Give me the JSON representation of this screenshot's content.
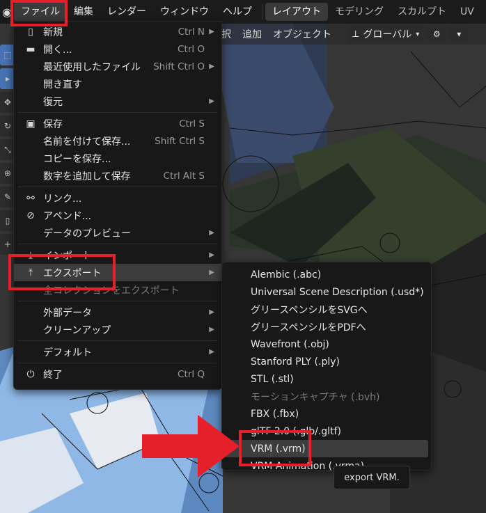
{
  "menubar": {
    "items": [
      "ファイル",
      "編集",
      "レンダー",
      "ウィンドウ",
      "ヘルプ"
    ],
    "workspaces": [
      "レイアウト",
      "モデリング",
      "スカルプト",
      "UV"
    ]
  },
  "viewport_header": {
    "items": [
      "択",
      "追加",
      "オブジェクト"
    ],
    "orientation": "グローバル"
  },
  "file_menu": {
    "groups": [
      [
        {
          "label": "新規",
          "shortcut": "Ctrl N",
          "arrow": true,
          "icon": "file-new-icon"
        },
        {
          "label": "開く...",
          "shortcut": "Ctrl O",
          "arrow": false,
          "icon": "folder-icon"
        },
        {
          "label": "最近使用したファイル",
          "shortcut": "Shift Ctrl O",
          "arrow": true,
          "icon": ""
        },
        {
          "label": "開き直す",
          "shortcut": "",
          "arrow": false,
          "icon": ""
        },
        {
          "label": "復元",
          "shortcut": "",
          "arrow": true,
          "icon": ""
        }
      ],
      [
        {
          "label": "保存",
          "shortcut": "Ctrl S",
          "arrow": false,
          "icon": "save-icon"
        },
        {
          "label": "名前を付けて保存...",
          "shortcut": "Shift Ctrl S",
          "arrow": false,
          "icon": ""
        },
        {
          "label": "コピーを保存...",
          "shortcut": "",
          "arrow": false,
          "icon": ""
        },
        {
          "label": "数字を追加して保存",
          "shortcut": "Ctrl Alt S",
          "arrow": false,
          "icon": ""
        }
      ],
      [
        {
          "label": "リンク...",
          "shortcut": "",
          "arrow": false,
          "icon": "link-icon"
        },
        {
          "label": "アペンド...",
          "shortcut": "",
          "arrow": false,
          "icon": "append-icon"
        },
        {
          "label": "データのプレビュー",
          "shortcut": "",
          "arrow": true,
          "icon": ""
        }
      ],
      [
        {
          "label": "インポート",
          "shortcut": "",
          "arrow": true,
          "icon": "import-icon"
        },
        {
          "label": "エクスポート",
          "shortcut": "",
          "arrow": true,
          "icon": "export-icon",
          "highlighted": true
        },
        {
          "label": "全コレクションをエクスポート",
          "shortcut": "",
          "arrow": false,
          "icon": "",
          "disabled": true
        }
      ],
      [
        {
          "label": "外部データ",
          "shortcut": "",
          "arrow": true,
          "icon": ""
        },
        {
          "label": "クリーンアップ",
          "shortcut": "",
          "arrow": true,
          "icon": ""
        }
      ],
      [
        {
          "label": "デフォルト",
          "shortcut": "",
          "arrow": true,
          "icon": ""
        }
      ],
      [
        {
          "label": "終了",
          "shortcut": "Ctrl Q",
          "arrow": false,
          "icon": "power-icon"
        }
      ]
    ]
  },
  "export_menu": {
    "items": [
      {
        "label": "Alembic (.abc)"
      },
      {
        "label": "Universal Scene Description (.usd*)"
      },
      {
        "label": "グリースペンシルをSVGへ"
      },
      {
        "label": "グリースペンシルをPDFへ"
      },
      {
        "label": "Wavefront (.obj)"
      },
      {
        "label": "Stanford PLY (.ply)"
      },
      {
        "label": "STL (.stl)"
      },
      {
        "label": "モーションキャプチャ (.bvh)",
        "disabled": true
      },
      {
        "label": "FBX (.fbx)"
      },
      {
        "label": "glTF 2.0 (.glb/.gltf)"
      },
      {
        "label": "VRM (.vrm)",
        "highlighted": true
      },
      {
        "label": "VRM Animation (.vrma)"
      }
    ]
  },
  "tooltip": {
    "text": "export VRM."
  },
  "colors": {
    "annotation": "#e5202a",
    "menu_bg": "#181818",
    "highlight": "#3d3d3d",
    "accent": "#4772b3"
  }
}
